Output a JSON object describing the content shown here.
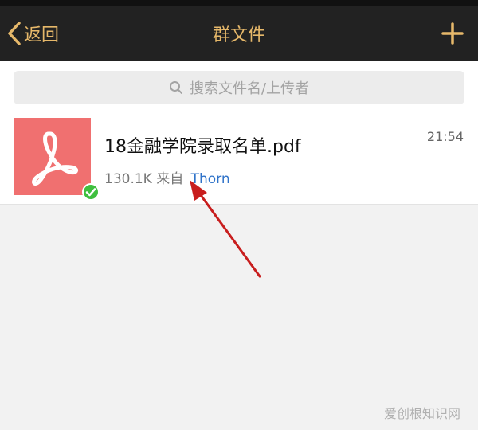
{
  "navbar": {
    "back_label": "返回",
    "title": "群文件",
    "add_icon": "plus-icon",
    "accent_color": "#e6b86a"
  },
  "search": {
    "placeholder": "搜索文件名/上传者",
    "icon": "search-icon"
  },
  "files": [
    {
      "name": "18金融学院录取名单.pdf",
      "size": "130.1K",
      "from_label": "来自",
      "sender": "Thorn",
      "time": "21:54",
      "type_icon": "pdf-icon",
      "status_icon": "check-icon",
      "thumb_color": "#f07070"
    }
  ],
  "watermark": "爱创根知识网"
}
